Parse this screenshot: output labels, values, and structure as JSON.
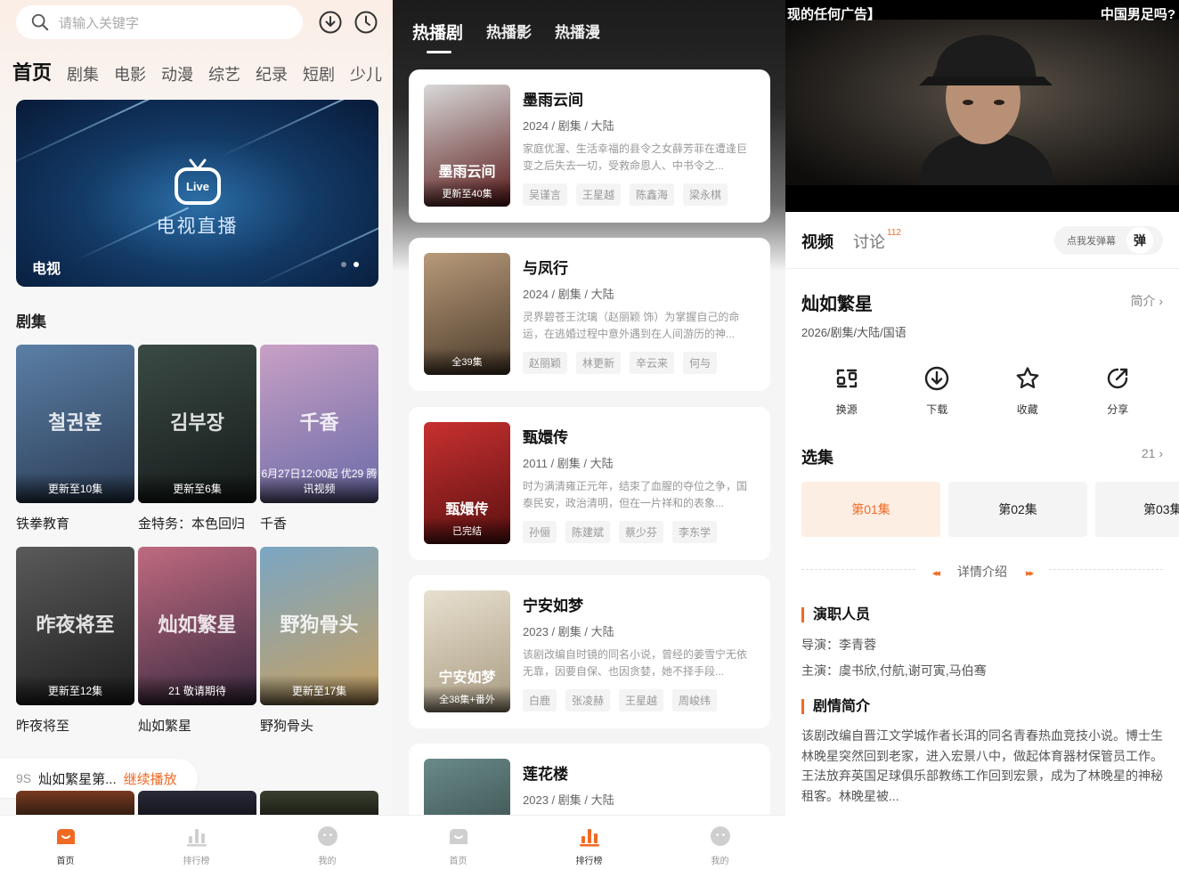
{
  "home": {
    "search": {
      "placeholder": "请输入关键字"
    },
    "header_icons": [
      "download-icon",
      "history-icon"
    ],
    "categories": [
      "首页",
      "剧集",
      "电影",
      "动漫",
      "综艺",
      "纪录",
      "短剧",
      "少儿"
    ],
    "banner": {
      "title": "电视直播",
      "logo_text": "Live",
      "label": "电视",
      "page_count": 2,
      "current_page": 2
    },
    "section_title": "剧集",
    "shows": [
      {
        "title": "铁拳教育",
        "badge": "更新至10集",
        "poster_text": "철권훈",
        "colors": [
          "#5b7fa6",
          "#2b3c55"
        ]
      },
      {
        "title": "金特务：本色回归",
        "badge": "更新至6集",
        "poster_text": "김부장",
        "colors": [
          "#3b4a45",
          "#151b1a"
        ]
      },
      {
        "title": "千香",
        "badge": "6月27日12:00起 优29 腾讯视频",
        "poster_text": "千香",
        "colors": [
          "#c8a0c4",
          "#6a6aa8"
        ]
      },
      {
        "title": "昨夜将至",
        "badge": "更新至12集",
        "poster_text": "昨夜将至",
        "colors": [
          "#5a5a5a",
          "#1e1e1e"
        ]
      },
      {
        "title": "灿如繁星",
        "badge": "21 敬请期待",
        "poster_text": "灿如繁星",
        "colors": [
          "#c06a80",
          "#3a2a40"
        ]
      },
      {
        "title": "野狗骨头",
        "badge": "更新至17集",
        "poster_text": "野狗骨头",
        "colors": [
          "#7aa6c4",
          "#c8a060"
        ]
      }
    ],
    "resume": {
      "time": "9S",
      "name": "灿如繁星第...",
      "action": "继续播放"
    },
    "peek_colors": [
      [
        "#7a3a20",
        "#2a1a10"
      ],
      [
        "#2a2a3a",
        "#14141c"
      ],
      [
        "#3a4030",
        "#1a1c14"
      ]
    ]
  },
  "ranking": {
    "tabs": [
      "热播剧",
      "热播影",
      "热播漫"
    ],
    "items": [
      {
        "title": "墨雨云间",
        "meta": "2024 / 剧集 / 大陆",
        "desc": "家庭优渥、生活幸福的县令之女薛芳菲在遭逢巨变之后失去一切，受救命恩人、中书令之...",
        "tags": [
          "吴谨言",
          "王星越",
          "陈鑫海",
          "梁永棋"
        ],
        "badge": "更新至40集",
        "poster_text": "墨雨云间",
        "colors": [
          "#d8d8d8",
          "#5a1a1a"
        ]
      },
      {
        "title": "与凤行",
        "meta": "2024 / 剧集 / 大陆",
        "desc": "灵界碧苍王沈璃（赵丽颖 饰）为掌握自己的命运，在逃婚过程中意外遇到在人间游历的神...",
        "tags": [
          "赵丽颖",
          "林更新",
          "辛云来",
          "何与"
        ],
        "badge": "全39集",
        "poster_text": "",
        "colors": [
          "#b89a7a",
          "#4a3a2a"
        ]
      },
      {
        "title": "甄嬛传",
        "meta": "2011 / 剧集 / 大陆",
        "desc": "时为满清雍正元年，结束了血腥的夺位之争，国泰民安，政治清明，但在一片祥和的表象...",
        "tags": [
          "孙俪",
          "陈建斌",
          "蔡少芬",
          "李东学"
        ],
        "badge": "已完结",
        "poster_text": "甄嬛传",
        "colors": [
          "#c83030",
          "#5a1010"
        ]
      },
      {
        "title": "宁安如梦",
        "meta": "2023 / 剧集 / 大陆",
        "desc": "该剧改编自时镜的同名小说，曾经的姜雪宁无依无靠，因要自保、也因贪婪，她不择手段...",
        "tags": [
          "白鹿",
          "张凌赫",
          "王星越",
          "周峻纬"
        ],
        "badge": "全38集+番外",
        "poster_text": "宁安如梦",
        "colors": [
          "#e8e0d0",
          "#a89a80"
        ]
      },
      {
        "title": "莲花楼",
        "meta": "2023 / 剧集 / 大陆",
        "desc": "",
        "tags": [],
        "badge": "",
        "poster_text": "莲花楼",
        "colors": [
          "#6a8a8a",
          "#2a3a3a"
        ]
      }
    ]
  },
  "detail": {
    "subtitle_left": "现的任何广告】",
    "subtitle_right": "中国男足吗?",
    "tabs": {
      "video": "视频",
      "discussion": "讨论",
      "discussion_count": "112"
    },
    "danmu": {
      "placeholder": "点我发弹幕",
      "button": "弹"
    },
    "title": "灿如繁星",
    "intro_link": "简介 ›",
    "meta": "2026/剧集/大陆/国语",
    "actions": [
      {
        "label": "换源",
        "icon": "switch-source-icon"
      },
      {
        "label": "下载",
        "icon": "download-icon"
      },
      {
        "label": "收藏",
        "icon": "star-icon"
      },
      {
        "label": "分享",
        "icon": "share-icon"
      }
    ],
    "episodes_title": "选集",
    "episode_count": "21 ›",
    "episodes": [
      "第01集",
      "第02集",
      "第03集"
    ],
    "details_label": "详情介绍",
    "cast_title": "演职人员",
    "director": "导演：李青蓉",
    "actors": "主演：虞书欣,付航,谢可寅,马伯骞",
    "synopsis_title": "剧情简介",
    "synopsis": "该剧改编自晋江文学城作者长洱的同名青春热血竞技小说。博士生林晚星突然回到老家，进入宏景八中，做起体育器材保管员工作。王法放弃英国足球俱乐部教练工作回到宏景，成为了林晚星的神秘租客。林晚星被..."
  },
  "tabbars": {
    "home_panel": [
      {
        "label": "首页",
        "active": true
      },
      {
        "label": "排行榜",
        "active": false
      },
      {
        "label": "我的",
        "active": false
      }
    ],
    "ranking_panel": [
      {
        "label": "首页",
        "active": false
      },
      {
        "label": "排行榜",
        "active": true
      },
      {
        "label": "我的",
        "active": false
      }
    ]
  },
  "colors": {
    "accent": "#f06a24",
    "inactive": "#cfcfcf"
  }
}
